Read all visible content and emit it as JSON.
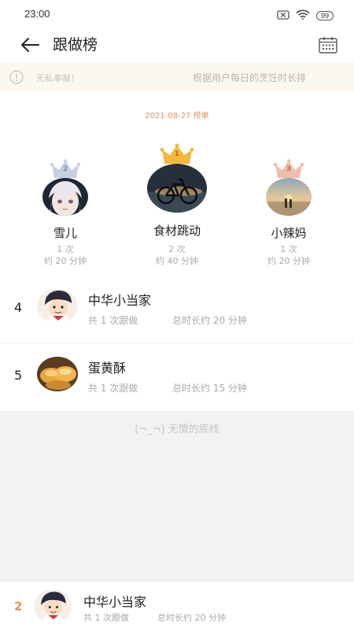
{
  "status_bar": {
    "time": "23:00",
    "battery": "99"
  },
  "nav": {
    "title": "跟做榜"
  },
  "notice": {
    "text_left": "无私奉献！",
    "text_right": "根据用户每日的烹饪时长排"
  },
  "board": {
    "date_label": "2021-08-27 榜单",
    "podium": [
      {
        "rank": "2",
        "name": "雪儿",
        "count": "1 次",
        "duration": "约 20 分钟"
      },
      {
        "rank": "1",
        "name": "食材跳动",
        "count": "2 次",
        "duration": "约 40 分钟"
      },
      {
        "rank": "3",
        "name": "小辣妈",
        "count": "1 次",
        "duration": "约 20 分钟"
      }
    ],
    "list": [
      {
        "rank": "4",
        "name": "中华小当家",
        "count": "共 1 次跟做",
        "duration": "总时长约 20 分钟"
      },
      {
        "rank": "5",
        "name": "蛋黄酥",
        "count": "共 1 次跟做",
        "duration": "总时长约 15 分钟"
      }
    ],
    "bottom_line": "(¬_¬) 无情的底线"
  },
  "my_rank": {
    "rank": "2",
    "name": "中华小当家",
    "count": "共 1 次跟做",
    "duration": "总时长约 20 分钟"
  },
  "colors": {
    "accent": "#e8915a",
    "gold": "#f4b93a",
    "silver": "#9fb0c8",
    "bronze": "#e9a98c"
  }
}
